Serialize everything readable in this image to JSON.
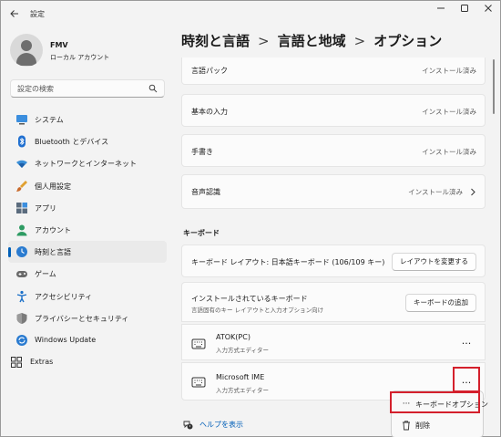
{
  "window": {
    "title": "設定"
  },
  "profile": {
    "name": "FMV",
    "account_type": "ローカル アカウント"
  },
  "search": {
    "placeholder": "設定の検索"
  },
  "sidebar": {
    "items": [
      {
        "label": "システム",
        "icon": "system-icon"
      },
      {
        "label": "Bluetooth とデバイス",
        "icon": "bluetooth-icon"
      },
      {
        "label": "ネットワークとインターネット",
        "icon": "network-icon"
      },
      {
        "label": "個人用設定",
        "icon": "brush-icon"
      },
      {
        "label": "アプリ",
        "icon": "apps-icon"
      },
      {
        "label": "アカウント",
        "icon": "account-icon"
      },
      {
        "label": "時刻と言語",
        "icon": "time-language-icon",
        "selected": true
      },
      {
        "label": "ゲーム",
        "icon": "gamepad-icon"
      },
      {
        "label": "アクセシビリティ",
        "icon": "accessibility-icon"
      },
      {
        "label": "プライバシーとセキュリティ",
        "icon": "shield-icon"
      },
      {
        "label": "Windows Update",
        "icon": "update-icon"
      },
      {
        "label": "Extras",
        "icon": "extras-icon"
      }
    ]
  },
  "breadcrumb": {
    "level1": "時刻と言語",
    "level2": "言語と地域",
    "level3": "オプション",
    "separator": ">"
  },
  "language_features": [
    {
      "label": "言語パック",
      "status": "インストール済み"
    },
    {
      "label": "基本の入力",
      "status": "インストール済み"
    },
    {
      "label": "手書き",
      "status": "インストール済み"
    },
    {
      "label": "音声認識",
      "status": "インストール済み"
    }
  ],
  "keyboard_section": {
    "title": "キーボード",
    "layout_label": "キーボード レイアウト: 日本語キーボード (106/109 キー)",
    "layout_button": "レイアウトを変更する",
    "installed_label": "インストールされているキーボード",
    "installed_sub": "言語固有のキー レイアウトと入力オプション向け",
    "add_button": "キーボードの追加",
    "keyboards": [
      {
        "name": "ATOK(PC)",
        "type": "入力方式エディター",
        "more": "..."
      },
      {
        "name": "Microsoft IME",
        "type": "入力方式エディター",
        "more": "..."
      }
    ]
  },
  "context_menu": {
    "items": [
      {
        "label": "キーボードオプション",
        "icon": "more-icon",
        "glyph": "···"
      },
      {
        "label": "削除",
        "icon": "trash-icon"
      }
    ]
  },
  "help": {
    "label": "ヘルプを表示"
  },
  "colors": {
    "accent": "#005fb8",
    "highlight": "#d4202c"
  }
}
